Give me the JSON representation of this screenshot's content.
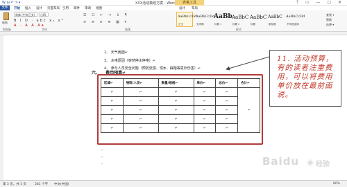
{
  "titlebar": {
    "quick_access": "W ⊟ ↶ ↷ ▾",
    "title": "XXX活动策划方案 - Word",
    "tool_tab": "表格工具",
    "window_controls": "? ▭ — ▢ ✕"
  },
  "tabs": [
    {
      "label": "文件"
    },
    {
      "label": "开始"
    },
    {
      "label": "插入"
    },
    {
      "label": "设计"
    },
    {
      "label": "页面布局"
    },
    {
      "label": "引用"
    },
    {
      "label": "邮件"
    },
    {
      "label": "审阅"
    },
    {
      "label": "视图"
    },
    {
      "label": "设计"
    },
    {
      "label": "布局"
    }
  ],
  "ribbon": {
    "paste_label": "粘贴",
    "font_name": "宋体 (中文正文)",
    "font_size": "小四",
    "format_row1": "B I U · abc x₂ x²",
    "format_row2": "A · A A Aa",
    "groups": [
      "剪贴板",
      "字体",
      "段落",
      "样式"
    ],
    "styles": [
      {
        "sample": "AaBbCcDd",
        "name": "正文",
        "size": "5px"
      },
      {
        "sample": "AaBbCcDd",
        "name": "无间隔",
        "size": "5px"
      },
      {
        "sample": "AaBb",
        "name": "标题 1",
        "size": "9px"
      },
      {
        "sample": "AaBbC",
        "name": "标题 2",
        "size": "7px"
      },
      {
        "sample": "AaBbC",
        "name": "标题",
        "size": "7px"
      },
      {
        "sample": "AaBbC",
        "name": "副标题",
        "size": "6px"
      },
      {
        "sample": "AaBbCcDd",
        "name": "不明显强调",
        "size": "5px"
      }
    ],
    "side": [
      "查找 ▾",
      "替换",
      "选择 ▾"
    ]
  },
  "document": {
    "lines": [
      {
        "num": "2、",
        "text": "天气雨因↵"
      },
      {
        "num": "3、",
        "text": "水电原因（突然停水停电）↵"
      },
      {
        "num": "4、",
        "text": "参与人员安全问题（预防流感、溺水、踩踏等意外伤害）↵"
      }
    ],
    "section_num": "六、",
    "section_title": "费用预算↵",
    "table_headers": [
      "区域↵",
      "物料/人员↵",
      "数量/规格↵",
      "单价↵",
      "总价↵",
      "合计↵"
    ],
    "cell_mark": "↵",
    "paragraph_marks": [
      "↵",
      "↵",
      "↵"
    ]
  },
  "annotation": {
    "text": "11. 活动预算，有的读者注重费用，可以将费用单价放在最前面说。"
  },
  "status": {
    "page": "第 3 页，共 3 页",
    "words": "281 个字",
    "lang": "中文(中国)",
    "zoom": "80%"
  },
  "watermark": {
    "brand": "Baidu",
    "sub": "经验"
  },
  "colors": {
    "accent": "#2b579a",
    "highlight_box": "#b23a3a",
    "annotation_text": "#c2392b"
  }
}
